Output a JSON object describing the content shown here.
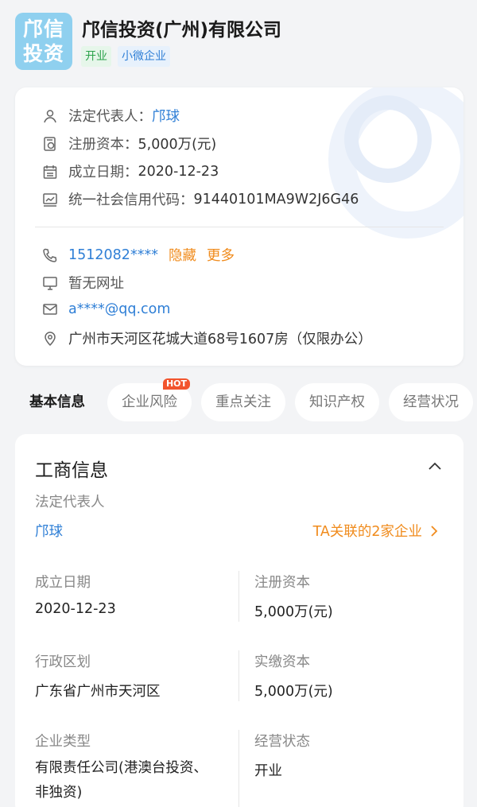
{
  "header": {
    "logo_line1": "邝信",
    "logo_line2": "投资",
    "company_name": "邝信投资(广州)有限公司",
    "tags": [
      "开业",
      "小微企业"
    ]
  },
  "info": {
    "legal_rep_label": "法定代表人：",
    "legal_rep_value": "邝球",
    "reg_capital_label": "注册资本：",
    "reg_capital_value": "5,000万(元)",
    "established_label": "成立日期：",
    "established_value": "2020-12-23",
    "credit_code_label": "统一社会信用代码：",
    "credit_code_value": "91440101MA9W2J6G46",
    "phone": "1512082****",
    "phone_hide": "隐藏",
    "phone_more": "更多",
    "website": "暂无网址",
    "email": "a****@qq.com",
    "address": "广州市天河区花城大道68号1607房（仅限办公）"
  },
  "tabs": [
    {
      "label": "基本信息"
    },
    {
      "label": "企业风险",
      "badge": "HOT"
    },
    {
      "label": "重点关注"
    },
    {
      "label": "知识产权"
    },
    {
      "label": "经营状况"
    }
  ],
  "business": {
    "title": "工商信息",
    "legal_rep_label": "法定代表人",
    "legal_rep_value": "邝球",
    "ta_link": "TA关联的2家企业",
    "fields": {
      "established_label": "成立日期",
      "established_value": "2020-12-23",
      "reg_capital_label": "注册资本",
      "reg_capital_value": "5,000万(元)",
      "region_label": "行政区划",
      "region_value": "广东省广州市天河区",
      "paid_capital_label": "实缴资本",
      "paid_capital_value": "5,000万(元)",
      "type_label": "企业类型",
      "type_value": "有限责任公司(港澳台投资、非独资)",
      "status_label": "经营状态",
      "status_value": "开业"
    }
  },
  "colors": {
    "link_blue": "#2f7fd6",
    "orange": "#f08b1c",
    "tag_green": "#2aa24a",
    "logo_bg": "#8fd0ef",
    "hot_red": "#f2542d"
  }
}
